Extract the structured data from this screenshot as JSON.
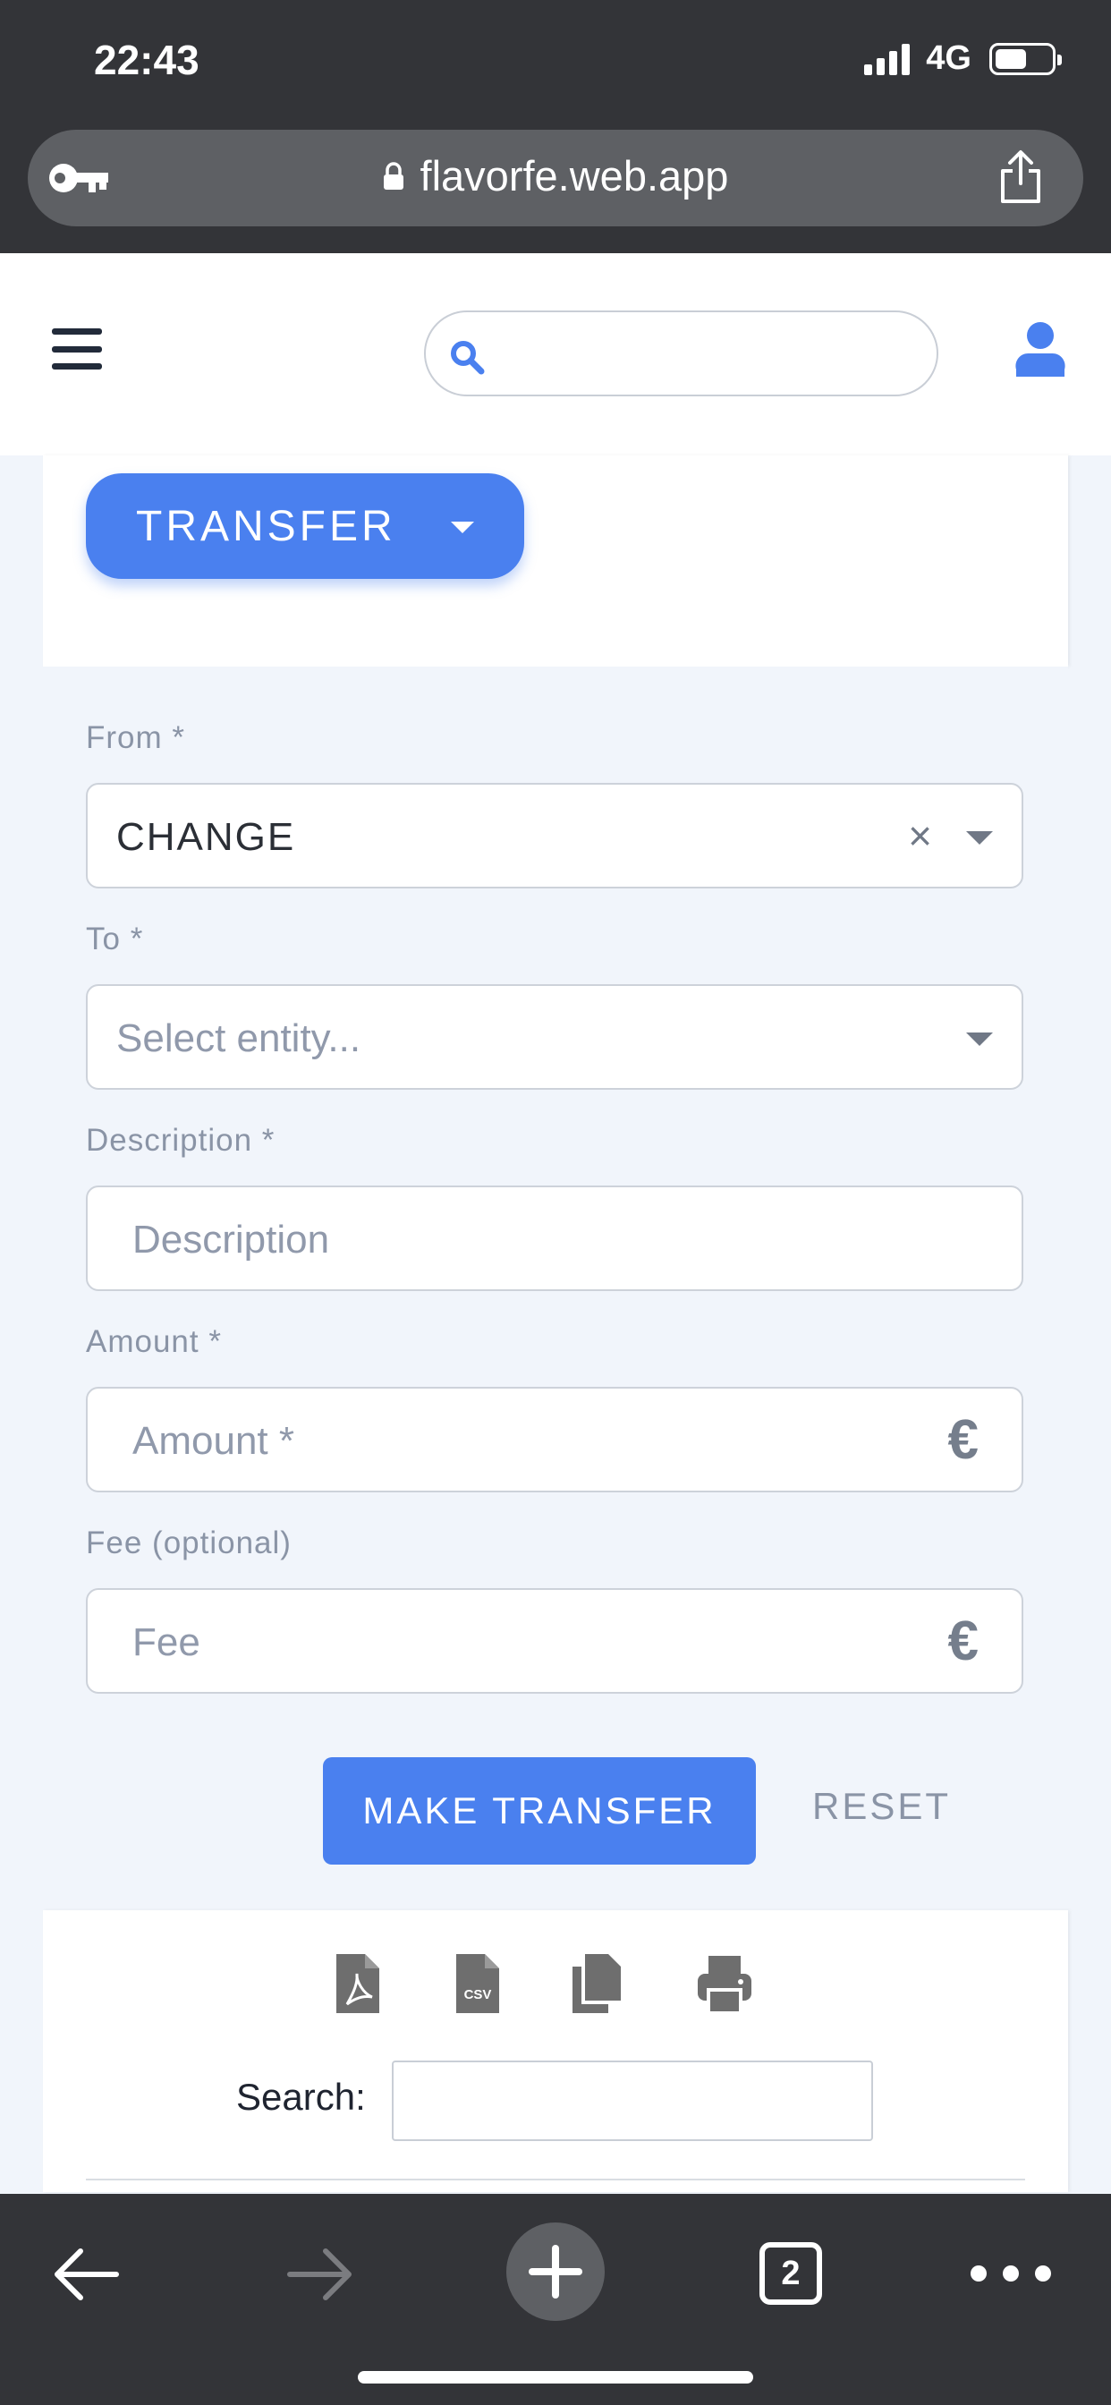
{
  "status_bar": {
    "time": "22:43",
    "network": "4G"
  },
  "browser": {
    "url": "flavorfe.web.app",
    "tab_count": "2"
  },
  "header": {
    "search_placeholder": ""
  },
  "action_menu": {
    "label": "TRANSFER"
  },
  "form": {
    "from": {
      "label": "From *",
      "value": "CHANGE",
      "clear_glyph": "×"
    },
    "to": {
      "label": "To *",
      "placeholder": "Select entity..."
    },
    "description": {
      "label": "Description *",
      "placeholder": "Description"
    },
    "amount": {
      "label": "Amount *",
      "placeholder": "Amount *",
      "currency": "€"
    },
    "fee": {
      "label": "Fee (optional)",
      "placeholder": "Fee",
      "currency": "€"
    },
    "submit_label": "MAKE TRANSFER",
    "reset_label": "RESET"
  },
  "table_tools": {
    "exports": [
      "pdf-icon",
      "csv-icon",
      "copy-icon",
      "print-icon"
    ],
    "search_label": "Search:"
  },
  "icons": {
    "status": [
      "signal-icon",
      "battery-icon"
    ],
    "browser": [
      "key-icon",
      "lock-icon",
      "share-icon",
      "back-icon",
      "forward-icon",
      "new-tab-icon",
      "tabs-icon",
      "more-icon"
    ],
    "header": [
      "menu-icon",
      "search-icon",
      "user-icon"
    ]
  },
  "colors": {
    "accent": "#4a80ef",
    "chrome": "#333438",
    "form_bg": "#f1f5fb",
    "label": "#8a94a6"
  }
}
